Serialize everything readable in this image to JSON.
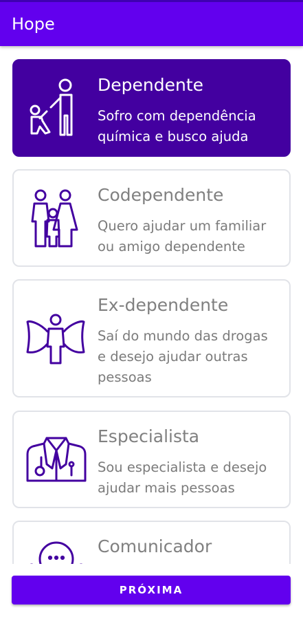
{
  "app": {
    "title": "Hope"
  },
  "colors": {
    "primary": "#6200ee",
    "selected_card": "#4300a0",
    "icon": "#4300a0"
  },
  "options": [
    {
      "title": "Dependente",
      "description": "Sofro com dependência química e busco ajuda",
      "icon": "person-helping-child-icon",
      "selected": true
    },
    {
      "title": "Codependente",
      "description": "Quero ajudar um familiar ou amigo dependente",
      "icon": "family-icon",
      "selected": false
    },
    {
      "title": "Ex-dependente",
      "description": "Saí do mundo das drogas e desejo ajudar outras pessoas",
      "icon": "angel-icon",
      "selected": false
    },
    {
      "title": "Especialista",
      "description": "Sou especialista e desejo ajudar mais pessoas",
      "icon": "doctor-coat-icon",
      "selected": false
    },
    {
      "title": "Comunicador",
      "description": "",
      "icon": "speaker-chat-icon",
      "selected": false
    }
  ],
  "footer": {
    "next_label": "PRÓXIMA"
  }
}
